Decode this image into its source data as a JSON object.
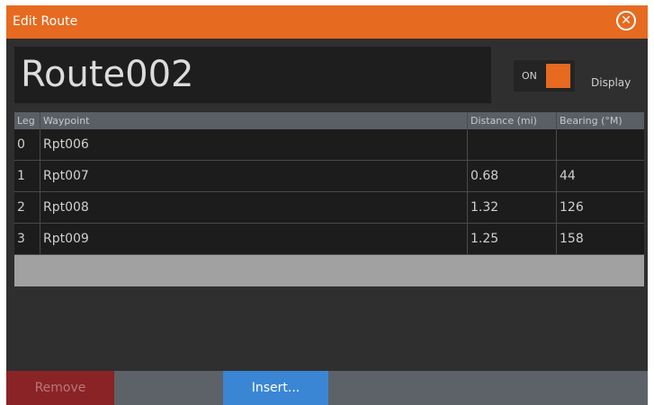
{
  "dialog": {
    "title": "Edit Route",
    "close_glyph": "✕"
  },
  "route": {
    "name": "Route002",
    "display_toggle": {
      "state": "ON",
      "label": "Display"
    }
  },
  "table": {
    "columns": [
      "Leg",
      "Waypoint",
      "Distance (mi)",
      "Bearing (°M)"
    ],
    "rows": [
      {
        "leg": "0",
        "waypoint": "Rpt006",
        "distance": "",
        "bearing": ""
      },
      {
        "leg": "1",
        "waypoint": "Rpt007",
        "distance": "0.68",
        "bearing": "44"
      },
      {
        "leg": "2",
        "waypoint": "Rpt008",
        "distance": "1.32",
        "bearing": "126"
      },
      {
        "leg": "3",
        "waypoint": "Rpt009",
        "distance": "1.25",
        "bearing": "158"
      }
    ]
  },
  "buttons": {
    "remove": "Remove",
    "insert": "Insert..."
  },
  "colors": {
    "accent": "#e66a20",
    "remove_button": "#8a2326",
    "insert_button": "#3a86d4"
  },
  "icons": {
    "close": "close-circle-icon"
  }
}
